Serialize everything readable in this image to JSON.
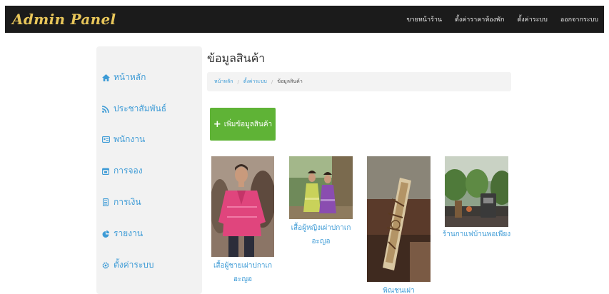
{
  "brand": "Admin Panel",
  "nav": [
    "ขายหน้าร้าน",
    "ตั้งค่าราคาห้องพัก",
    "ตั้งค่าระบบ",
    "ออกจากระบบ"
  ],
  "sidebar": {
    "items": [
      {
        "label": "หน้าหลัก",
        "icon": "home-icon"
      },
      {
        "label": "ประชาสัมพันธ์",
        "icon": "rss-icon"
      },
      {
        "label": "พนักงาน",
        "icon": "id-card-icon"
      },
      {
        "label": "การจอง",
        "icon": "calendar-icon"
      },
      {
        "label": "การเงิน",
        "icon": "money-icon"
      },
      {
        "label": "รายงาน",
        "icon": "chart-icon"
      },
      {
        "label": "ตั้งค่าระบบ",
        "icon": "gear-icon"
      }
    ]
  },
  "page": {
    "title": "ข้อมูลสินค้า",
    "breadcrumb": [
      "หน้าหลัก",
      "ตั้งค่าระบบ",
      "ข้อมูลสินค้า"
    ],
    "add_button": "เพิ่มข้อมูลสินค้า"
  },
  "products": [
    {
      "name_line1": "เสื้อผู้ชายเผ่าปกาเก",
      "name_line2": "อะญอ"
    },
    {
      "name_line1": "เสื้อผู้หญิงเผ่าปกาเก",
      "name_line2": "อะญอ"
    },
    {
      "name_line1": "พิณชนเผ่า",
      "name_line2": ""
    },
    {
      "name_line1": "ร้านกาแฟบ้านพอเพียง",
      "name_line2": ""
    }
  ],
  "colors": {
    "link": "#3d9bd6",
    "add_button": "#5fb336",
    "brand": "#e8c65a",
    "navbar": "#1b1b1b"
  }
}
